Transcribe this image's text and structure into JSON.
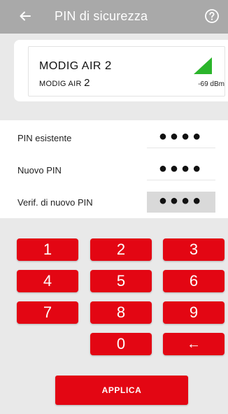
{
  "header": {
    "title": "PIN di sicurezza",
    "back_icon": "arrow-left-icon",
    "help_icon": "help-circle-icon",
    "bg_color": "#a9a9a9"
  },
  "device": {
    "name": "MODIG AIR",
    "name_number": "2",
    "model": "MODIG AIR",
    "model_number": "2",
    "signal": "-69 dBm",
    "signal_icon": "signal-strength-icon",
    "signal_color": "#2bb52b"
  },
  "pin_fields": [
    {
      "label": "PIN esistente",
      "value": "●●●●"
    },
    {
      "label": "Nuovo PIN",
      "value": "●●●●"
    },
    {
      "label": "Verif. di nuovo PIN",
      "value": "●●●●"
    }
  ],
  "keypad": {
    "keys": [
      "1",
      "2",
      "3",
      "4",
      "5",
      "6",
      "7",
      "8",
      "9",
      "0",
      "←"
    ],
    "key_color": "#e30613"
  },
  "apply": {
    "label": "APPLICA"
  }
}
